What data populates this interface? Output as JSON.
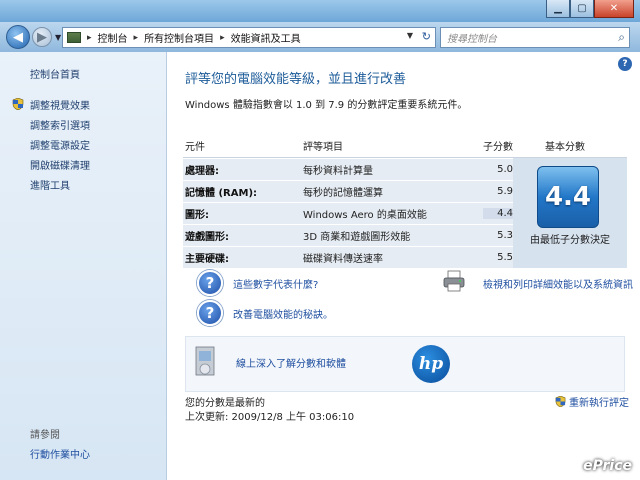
{
  "navbar": {
    "breadcrumbs": [
      "控制台",
      "所有控制台項目",
      "效能資訊及工具"
    ],
    "search_placeholder": "搜尋控制台"
  },
  "sidebar": {
    "home": "控制台首頁",
    "items": [
      {
        "label": "調整視覺效果",
        "icon": "shield-icon"
      },
      {
        "label": "調整索引選項",
        "icon": ""
      },
      {
        "label": "調整電源設定",
        "icon": ""
      },
      {
        "label": "開啟磁碟清理",
        "icon": ""
      },
      {
        "label": "進階工具",
        "icon": ""
      }
    ],
    "see_also": "請參閱",
    "action_center": "行動作業中心"
  },
  "main": {
    "title": "評等您的電腦效能等級，並且進行改善",
    "intro": "Windows 體驗指數會以 1.0 到 7.9 的分數評定重要系統元件。",
    "columns": [
      "元件",
      "評等項目",
      "子分數",
      "基本分數"
    ],
    "rows": [
      {
        "component": "處理器:",
        "rating": "每秒資料計算量",
        "score": "5.0"
      },
      {
        "component": "記憶體 (RAM):",
        "rating": "每秒的記憶體運算",
        "score": "5.9"
      },
      {
        "component": "圖形:",
        "rating": "Windows Aero 的桌面效能",
        "score": "4.4"
      },
      {
        "component": "遊戲圖形:",
        "rating": "3D 商業和遊戲圖形效能",
        "score": "5.3"
      },
      {
        "component": "主要硬碟:",
        "rating": "磁碟資料傳送速率",
        "score": "5.5"
      }
    ],
    "base_score": "4.4",
    "base_score_label": "由最低子分數決定",
    "link_what_mean": "這些數字代表什麼?",
    "link_tips": "改善電腦效能的秘訣。",
    "link_print": "檢視和列印詳細效能以及系統資訊",
    "link_online": "線上深入了解分數和軟體",
    "hp_logo": "hp",
    "status_current": "您的分數是最新的",
    "last_update": "上次更新: 2009/12/8 上午 03:06:10",
    "rerun": "重新執行評定"
  },
  "watermark": "ePrice",
  "colors": {
    "accent": "#1e5c9a",
    "link": "#1f4fa0",
    "badge": "#2277c8"
  }
}
